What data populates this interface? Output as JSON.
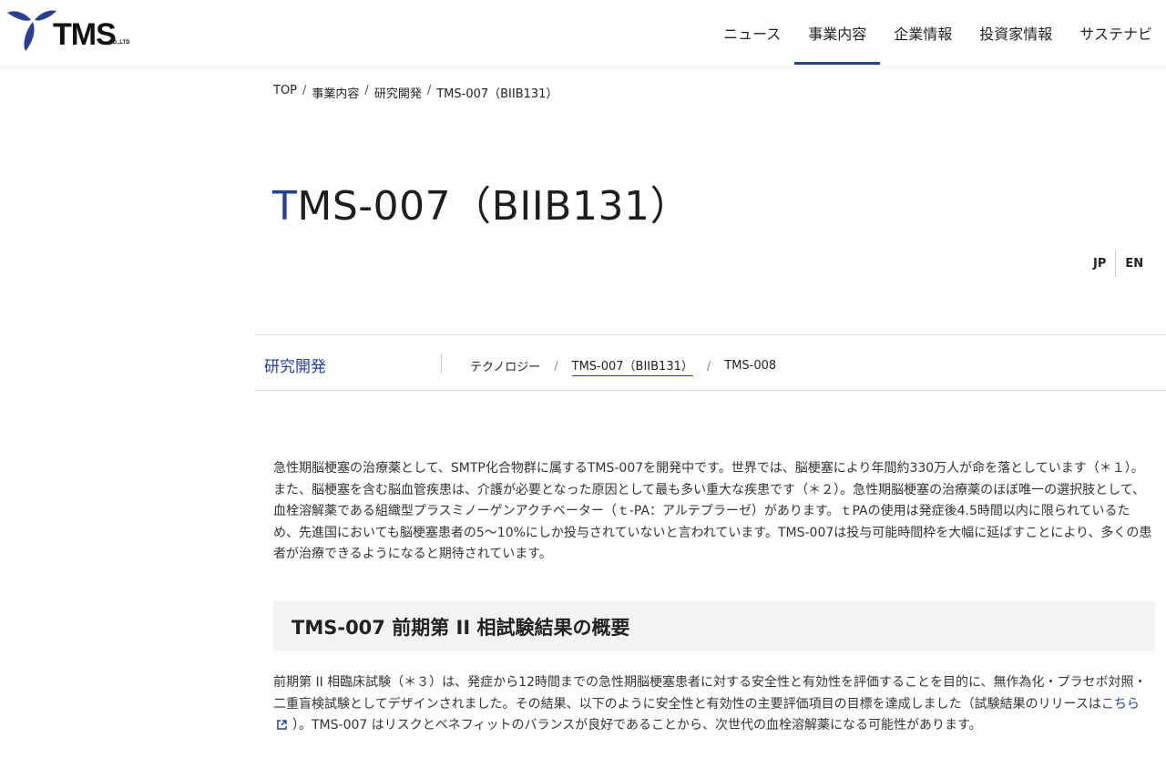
{
  "header": {
    "logo_text": "TMS",
    "logo_sub": "CO.,LTD",
    "nav": [
      {
        "label": "ニュース",
        "active": false
      },
      {
        "label": "事業内容",
        "active": true
      },
      {
        "label": "企業情報",
        "active": false
      },
      {
        "label": "投資家情報",
        "active": false
      },
      {
        "label": "サステナビ",
        "active": false
      }
    ]
  },
  "breadcrumb": [
    "TOP",
    "事業内容",
    "研究開発",
    "TMS-007（BIIB131）"
  ],
  "title": {
    "first": "T",
    "rest": "MS-007（BIIB131）"
  },
  "lang": {
    "jp": "JP",
    "en": "EN"
  },
  "subnav": {
    "title": "研究開発",
    "items": [
      {
        "label": "テクノロジー",
        "active": false
      },
      {
        "label": "TMS-007（BIIB131）",
        "active": true
      },
      {
        "label": "TMS-008",
        "active": false
      }
    ],
    "separator": "/"
  },
  "content": {
    "intro": "急性期脳梗塞の治療薬として、SMTP化合物群に属するTMS-007を開発中です。世界では、脳梗塞により年間約330万人が命を落としています（＊１）。また、脳梗塞を含む脳血管疾患は、介護が必要となった原因として最も多い重大な疾患です（＊２）。急性期脳梗塞の治療薬のほぼ唯一の選択肢として、血栓溶解薬である組織型プラスミノーゲンアクチベーター（ｔ-PA：アルテプラーゼ）があります。ｔPAの使用は発症後4.5時間以内に限られているため、先進国においても脳梗塞患者の5〜10%にしか投与されていないと言われています。TMS-007は投与可能時間枠を大幅に延ばすことにより、多くの患者が治療できるようになると期待されています。",
    "section_title": "TMS-007 前期第 II 相試験結果の概要",
    "para2_before": "前期第 II 相臨床試験（＊３）は、発症から12時間までの急性期脳梗塞患者に対する安全性と有効性を評価することを目的に、無作為化・プラセボ対照・二重盲検試験としてデザインされました。その結果、以下のように安全性と有効性の主要評価項目の目標を達成しました（試験結果のリリースは",
    "para2_link": "こちら",
    "para2_after": "）。TMS-007 はリスクとベネフィットのバランスが良好であることから、次世代の血栓溶解薬になる可能性があります。"
  },
  "colors": {
    "accent": "#2a3f8f",
    "section_bg": "#f3f3f3"
  }
}
